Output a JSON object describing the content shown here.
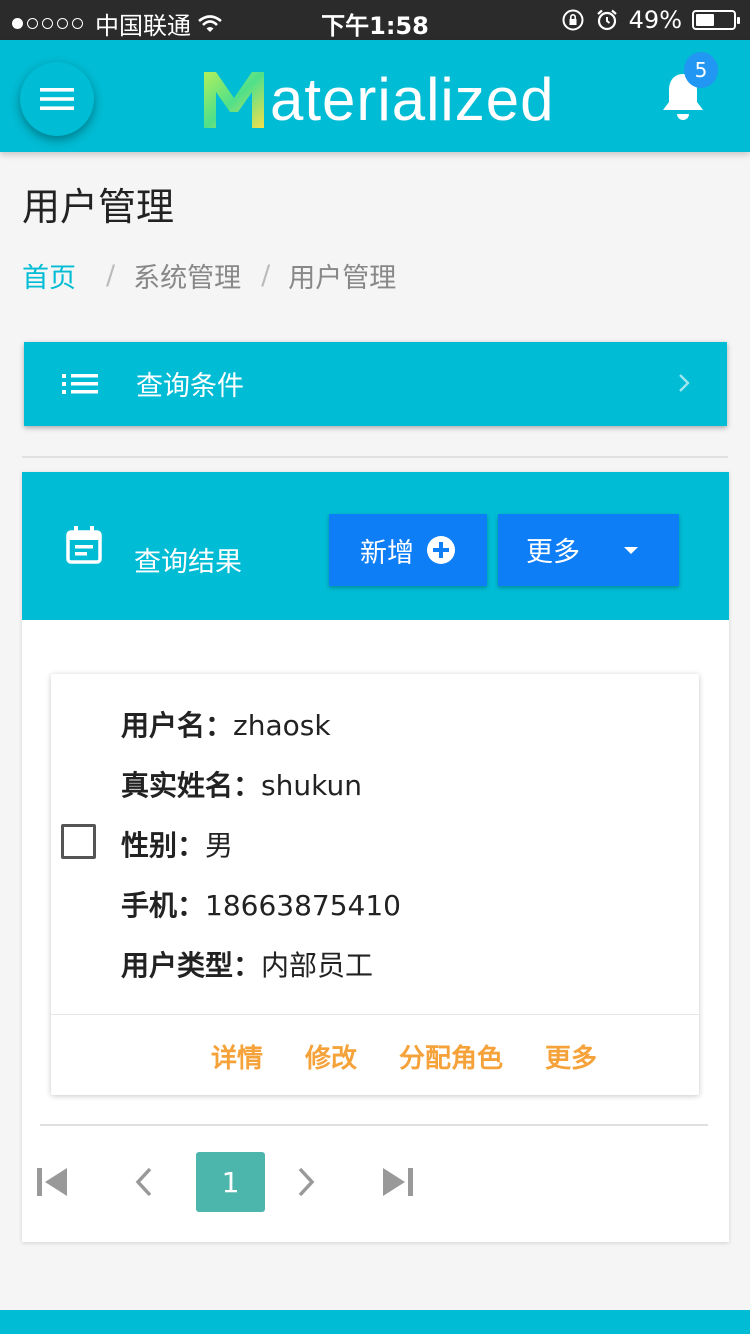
{
  "status_bar": {
    "carrier": "中国联通",
    "time": "下午1:58",
    "battery": "49%",
    "icons": [
      "signal-dots-icon",
      "wifi-icon",
      "orientation-lock-icon",
      "alarm-icon",
      "battery-icon"
    ]
  },
  "app_bar": {
    "brand_initial": "M",
    "brand_rest": "aterialized",
    "notification_count": "5",
    "icons": [
      "hamburger-menu-icon",
      "bell-icon"
    ]
  },
  "page": {
    "title": "用户管理",
    "breadcrumb": {
      "home": "首页",
      "separator": "/",
      "level2": "系统管理",
      "level3": "用户管理"
    }
  },
  "query_conditions": {
    "label": "查询条件",
    "icons": [
      "list-icon",
      "chevron-right-icon"
    ]
  },
  "results": {
    "title": "查询结果",
    "add_button": "新增",
    "more_button": "更多",
    "icons": [
      "calendar-icon",
      "plus-circle-icon",
      "caret-down-icon"
    ]
  },
  "user_record": {
    "fields": [
      {
        "label": "用户名：",
        "value": "zhaosk"
      },
      {
        "label": "真实姓名：",
        "value": "shukun"
      },
      {
        "label": "性别：",
        "value": "男"
      },
      {
        "label": "手机：",
        "value": "18663875410"
      },
      {
        "label": "用户类型：",
        "value": "内部员工"
      }
    ],
    "actions": [
      "详情",
      "修改",
      "分配角色",
      "更多"
    ]
  },
  "pagination": {
    "current_page": "1",
    "icons": [
      "first-page-icon",
      "prev-page-icon",
      "next-page-icon",
      "last-page-icon"
    ]
  },
  "colors": {
    "primary": "#00bcd4",
    "button_blue": "#0d7ef5",
    "action_orange": "#f5a23a",
    "page_active": "#4db6ac",
    "badge": "#2196f3"
  }
}
